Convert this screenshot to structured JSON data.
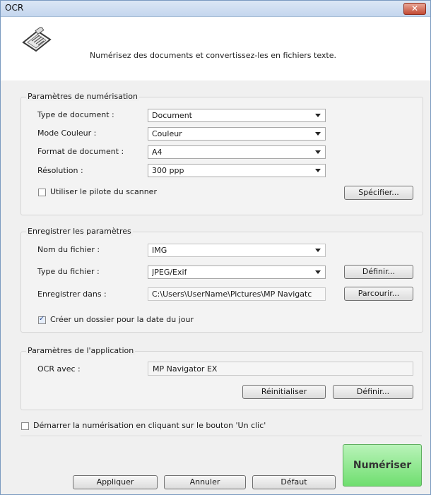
{
  "window": {
    "title": "OCR",
    "close_label": "✕"
  },
  "header": {
    "icon": "scanner-document-icon",
    "description": "Numérisez des documents et convertissez-les en fichiers texte."
  },
  "scan_settings": {
    "title": "Paramètres de numérisation",
    "doc_type_label": "Type de document :",
    "doc_type_value": "Document",
    "color_mode_label": "Mode Couleur :",
    "color_mode_value": "Couleur",
    "doc_size_label": "Format de document :",
    "doc_size_value": "A4",
    "resolution_label": "Résolution :",
    "resolution_value": "300 ppp",
    "use_driver_label": "Utiliser le pilote du scanner",
    "use_driver_checked": false,
    "specify_button": "Spécifier..."
  },
  "save_settings": {
    "title": "Enregistrer les paramètres",
    "filename_label": "Nom du fichier :",
    "filename_value": "IMG",
    "filetype_label": "Type du fichier :",
    "filetype_value": "JPEG/Exif",
    "define_button": "Définir...",
    "save_in_label": "Enregistrer dans :",
    "save_in_value": "C:\\Users\\UserName\\Pictures\\MP Navigatc",
    "browse_button": "Parcourir...",
    "date_folder_label": "Créer un dossier pour la date du jour",
    "date_folder_checked": true
  },
  "app_settings": {
    "title": "Paramètres de l'application",
    "ocr_label": "OCR avec :",
    "ocr_value": "MP Navigator EX",
    "reset_button": "Réinitialiser",
    "define_button": "Définir..."
  },
  "one_click": {
    "label": "Démarrer la numérisation en cliquant sur le bouton 'Un clic'",
    "checked": false
  },
  "footer": {
    "apply": "Appliquer",
    "cancel": "Annuler",
    "default": "Défaut",
    "scan": "Numériser"
  }
}
